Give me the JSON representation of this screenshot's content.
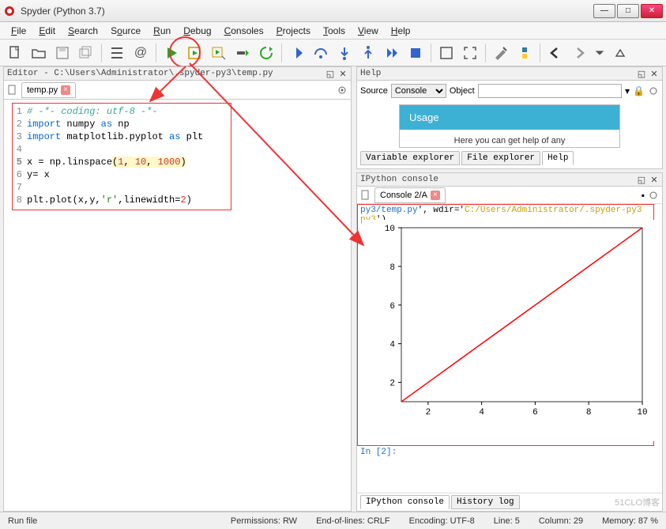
{
  "title": "Spyder (Python 3.7)",
  "menu": [
    "File",
    "Edit",
    "Search",
    "Source",
    "Run",
    "Debug",
    "Consoles",
    "Projects",
    "Tools",
    "View",
    "Help"
  ],
  "menu_ul": [
    "F",
    "E",
    "S",
    "o",
    "R",
    "D",
    "C",
    "P",
    "T",
    "V",
    "H"
  ],
  "editor_header": "Editor - C:\\Users\\Administrator\\.spyder-py3\\temp.py",
  "editor_tab": "temp.py",
  "code": {
    "l1": "# -*- coding: utf-8 -*-",
    "l2a": "import",
    "l2b": " numpy ",
    "l2c": "as",
    "l2d": " np",
    "l3a": "import",
    "l3b": " matplotlib.pyplot ",
    "l3c": "as",
    "l3d": " plt",
    "l5a": "x = np.linspace",
    "l5p": "(",
    "l5n1": "1",
    "l5c1": ", ",
    "l5n2": "10",
    "l5c2": ", ",
    "l5n3": "1000",
    "l5q": ")",
    "l6": "y= x",
    "l8a": "plt.plot(x,y,",
    "l8s": "'r'",
    "l8b": ",linewidth=",
    "l8n": "2",
    "l8c": ")"
  },
  "help_header": "Help",
  "help": {
    "source_label": "Source",
    "source_value": "Console",
    "object_label": "Object",
    "usage_title": "Usage",
    "usage_text": "Here you can get help of any"
  },
  "help_tabs": [
    "Variable explorer",
    "File explorer",
    "Help"
  ],
  "console_header": "IPython console",
  "console_tab": "Console 2/A",
  "console_cmd_a": "py3/temp.py",
  "console_cmd_b": "', wdir='",
  "console_cmd_c": "C:/Users/Administrator/.spyder-py3",
  "console_cmd_d": "')",
  "console_in": "In [2]:",
  "bottom_tabs": [
    "IPython console",
    "History log"
  ],
  "status": {
    "runfile": "Run file",
    "perm": "Permissions: RW",
    "eol": "End-of-lines: CRLF",
    "enc": "Encoding: UTF-8",
    "line": "Line: 5",
    "col": "Column: 29",
    "mem": "Memory:  87 %"
  },
  "chart_data": {
    "type": "line",
    "x": [
      1,
      2,
      3,
      4,
      5,
      6,
      7,
      8,
      9,
      10
    ],
    "y": [
      1,
      2,
      3,
      4,
      5,
      6,
      7,
      8,
      9,
      10
    ],
    "color": "#ff0000",
    "xlim": [
      1,
      10
    ],
    "ylim": [
      1,
      10
    ],
    "xticks": [
      2,
      4,
      6,
      8,
      10
    ],
    "yticks": [
      2,
      4,
      6,
      8,
      10
    ],
    "title": "",
    "xlabel": "",
    "ylabel": ""
  },
  "watermark": "51CLO博客"
}
